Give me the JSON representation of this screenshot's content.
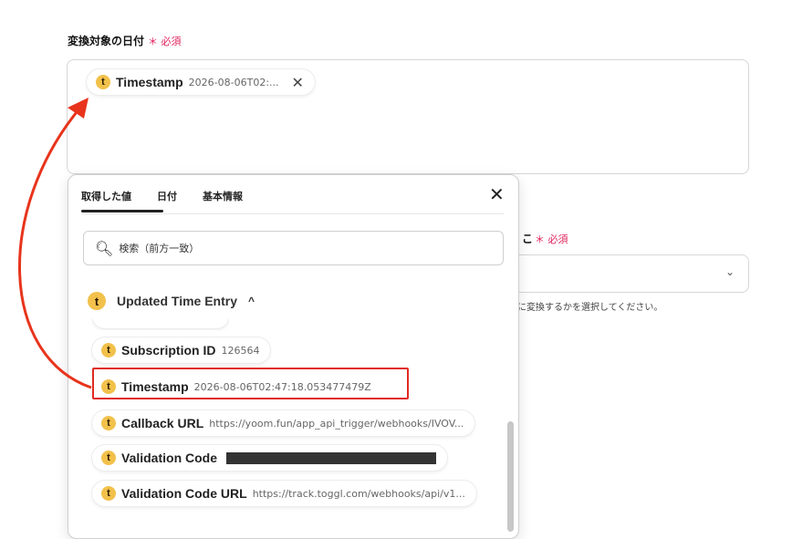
{
  "field": {
    "label": "変換対象の日付",
    "required": "＊ 必須",
    "chip": {
      "key": "Timestamp",
      "value": "2026-08-06T02:...",
      "close": "✕"
    }
  },
  "background_field": {
    "label": "こ",
    "required": "＊ 必須",
    "help": "に変換するかを選択してください。",
    "chevron": "⌄"
  },
  "popup": {
    "tabs": [
      {
        "label": "取得した値",
        "active": true
      },
      {
        "label": "日付",
        "active": false
      },
      {
        "label": "基本情報",
        "active": false
      }
    ],
    "close": "✕",
    "search": {
      "icon": "search-icon",
      "placeholder": "検索（前方一致）"
    },
    "group": {
      "title": "Updated Time Entry",
      "icon_letter": "t",
      "chevron": "^"
    },
    "items": [
      {
        "key": "Subscription ID",
        "value": "126564"
      },
      {
        "key": "Timestamp",
        "value": "2026-08-06T02:47:18.053477479Z",
        "highlighted": true
      },
      {
        "key": "Callback URL",
        "value": "https://yoom.fun/app_api_trigger/webhooks/IVOV..."
      },
      {
        "key": "Validation Code",
        "value": "",
        "masked": true
      },
      {
        "key": "Validation Code URL",
        "value": "https://track.toggl.com/webhooks/api/v1..."
      }
    ]
  },
  "colors": {
    "accent_required": "#e0245e",
    "highlight": "#e02b20",
    "toggl_icon": "#f2c14b"
  }
}
